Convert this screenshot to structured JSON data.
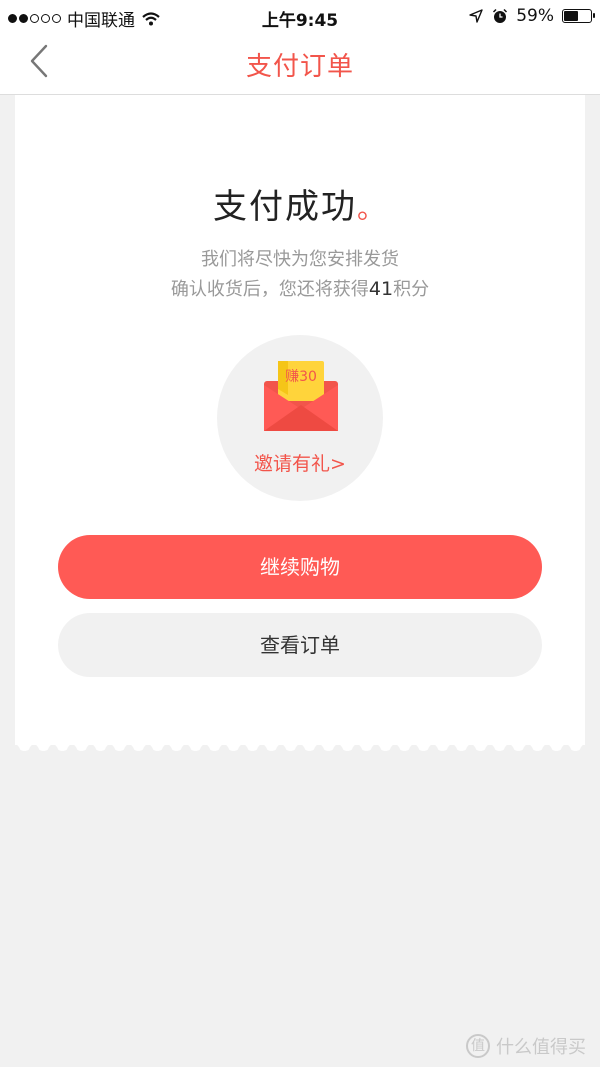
{
  "status_bar": {
    "carrier": "中国联通",
    "time": "上午9:45",
    "battery_percent": "59%",
    "battery_level": 0.59,
    "signal_strength": 2
  },
  "nav": {
    "title": "支付订单"
  },
  "success": {
    "title": "支付成功",
    "dot": "。",
    "message_line1": "我们将尽快为您安排发货",
    "message_line2_prefix": "确认收货后，您还将获得",
    "points": "41",
    "message_line2_suffix": "积分"
  },
  "invite": {
    "badge": "赚30",
    "label": "邀请有礼>"
  },
  "buttons": {
    "continue_shopping": "继续购物",
    "view_order": "查看订单"
  },
  "watermark": {
    "text": "什么值得买",
    "icon_char": "值"
  },
  "colors": {
    "accent": "#f2554b",
    "primary_button": "#ff5a55",
    "background": "#f1f1f1"
  }
}
